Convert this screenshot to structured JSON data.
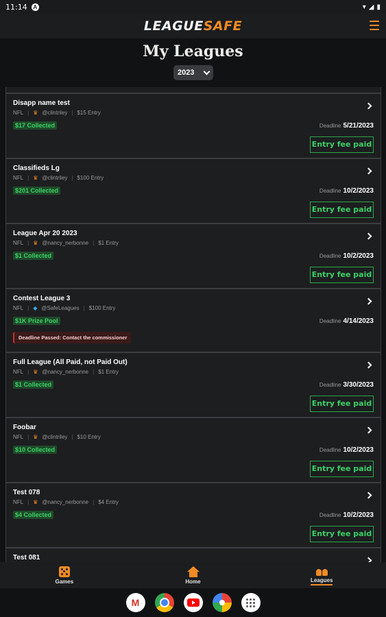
{
  "status_bar": {
    "time": "11:14",
    "notif": "A"
  },
  "header": {
    "logo_league": "LEAGUE",
    "logo_safe": "SAFE"
  },
  "page": {
    "title": "My Leagues",
    "year": "2023"
  },
  "leagues": [
    {
      "name": "Disapp name test",
      "sport": "NFL",
      "owner": "@clintriley",
      "entry": "$15 Entry",
      "badge": "$17 Collected",
      "deadline_label": "Deadline",
      "deadline": "5/21/2023",
      "button": "Entry fee paid"
    },
    {
      "name": "Classifieds Lg",
      "sport": "NFL",
      "owner": "@clintriley",
      "entry": "$100 Entry",
      "badge": "$201 Collected",
      "deadline_label": "Deadline",
      "deadline": "10/2/2023",
      "button": "Entry fee paid"
    },
    {
      "name": "League Apr 20 2023",
      "sport": "NFL",
      "owner": "@nancy_nerbonne",
      "entry": "$1 Entry",
      "badge": "$1 Collected",
      "deadline_label": "Deadline",
      "deadline": "10/2/2023",
      "button": "Entry fee paid"
    },
    {
      "name": "Contest League 3",
      "sport": "NFL",
      "owner": "@SafeLeagues",
      "entry": "$100 Entry",
      "badge": "$1K Prize Pool",
      "deadline_label": "Deadline",
      "deadline": "4/14/2023",
      "warning": "Deadline Passed: Contact the commissioner"
    },
    {
      "name": "Full League (All Paid, not Paid Out)",
      "sport": "NFL",
      "owner": "@nancy_nerbonne",
      "entry": "$1 Entry",
      "badge": "$1 Collected",
      "deadline_label": "Deadline",
      "deadline": "3/30/2023",
      "button": "Entry fee paid"
    },
    {
      "name": "Foobar",
      "sport": "NFL",
      "owner": "@clintriley",
      "entry": "$10 Entry",
      "badge": "$10 Collected",
      "deadline_label": "Deadline",
      "deadline": "10/2/2023",
      "button": "Entry fee paid"
    },
    {
      "name": "Test 078",
      "sport": "NFL",
      "owner": "@nancy_nerbonne",
      "entry": "$4 Entry",
      "badge": "$4 Collected",
      "deadline_label": "Deadline",
      "deadline": "10/2/2023",
      "button": "Entry fee paid"
    },
    {
      "name": "Test 081"
    }
  ],
  "bottom_nav": [
    {
      "label": "Games",
      "icon": "dice-icon"
    },
    {
      "label": "Home",
      "icon": "home-icon"
    },
    {
      "label": "Leagues",
      "icon": "people-icon",
      "active": true
    }
  ],
  "dock": [
    "gmail-icon",
    "chrome-icon",
    "youtube-icon",
    "photos-icon",
    "apps-icon"
  ],
  "colors": {
    "accent": "#f08b24",
    "paid_green": "#3ad166",
    "warning_red": "#c9302c",
    "background": "#111213"
  }
}
